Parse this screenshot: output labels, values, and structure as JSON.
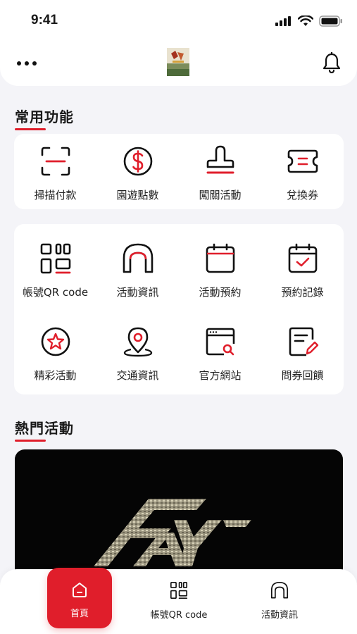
{
  "status_bar": {
    "time": "9:41"
  },
  "header": {
    "more_icon": "more-horizontal-icon",
    "bell_icon": "bell-icon"
  },
  "common_functions": {
    "title": "常用功能",
    "row1": [
      {
        "label": "掃描付款",
        "icon": "scan-icon"
      },
      {
        "label": "園遊點數",
        "icon": "dollar-coin-icon"
      },
      {
        "label": "闖關活動",
        "icon": "stamp-icon"
      },
      {
        "label": "兌換券",
        "icon": "ticket-icon"
      }
    ],
    "row2": [
      {
        "label": "帳號QR code",
        "icon": "qr-code-icon"
      },
      {
        "label": "活動資訊",
        "icon": "arch-icon"
      },
      {
        "label": "活動預約",
        "icon": "calendar-icon"
      },
      {
        "label": "預約記錄",
        "icon": "calendar-check-icon"
      }
    ],
    "row3": [
      {
        "label": "精彩活動",
        "icon": "star-circle-icon"
      },
      {
        "label": "交通資訊",
        "icon": "location-pin-icon"
      },
      {
        "label": "官方網站",
        "icon": "browser-search-icon"
      },
      {
        "label": "問券回饋",
        "icon": "survey-edit-icon"
      }
    ]
  },
  "hot_events": {
    "title": "熱門活動"
  },
  "tab_bar": {
    "tabs": [
      {
        "label": "首頁",
        "icon": "home-icon",
        "active": true
      },
      {
        "label": "帳號QR code",
        "icon": "qr-code-icon",
        "active": false
      },
      {
        "label": "活動資訊",
        "icon": "arch-icon",
        "active": false
      }
    ]
  },
  "colors": {
    "accent": "#e01e2b",
    "background": "#f4f4f8",
    "card": "#ffffff"
  }
}
